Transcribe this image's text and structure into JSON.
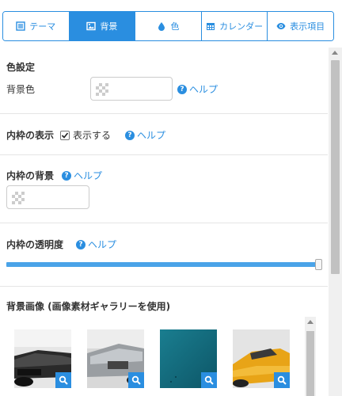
{
  "tabs": [
    {
      "label": "テーマ",
      "icon": "list-icon"
    },
    {
      "label": "背景",
      "icon": "image-icon",
      "active": true
    },
    {
      "label": "色",
      "icon": "droplet-icon"
    },
    {
      "label": "カレンダー",
      "icon": "calendar-icon"
    },
    {
      "label": "表示項目",
      "icon": "eye-icon"
    }
  ],
  "color_settings": {
    "title": "色設定",
    "bg_color_label": "背景色",
    "help": "ヘルプ"
  },
  "inner_frame_display": {
    "title": "内枠の表示",
    "checkbox_label": "表示する",
    "checked": true,
    "help": "ヘルプ"
  },
  "inner_frame_bg": {
    "title": "内枠の背景",
    "help": "ヘルプ"
  },
  "inner_frame_opacity": {
    "title": "内枠の透明度",
    "help": "ヘルプ",
    "value_percent": 100
  },
  "bg_image": {
    "title": "背景画像 (画像素材ギャラリーを使用)",
    "images": [
      {
        "name": "black-car"
      },
      {
        "name": "silver-car"
      },
      {
        "name": "teal-texture"
      },
      {
        "name": "yellow-sports-car"
      }
    ]
  },
  "colors": {
    "accent": "#2a8ee0",
    "slider": "#4aa3e8"
  }
}
